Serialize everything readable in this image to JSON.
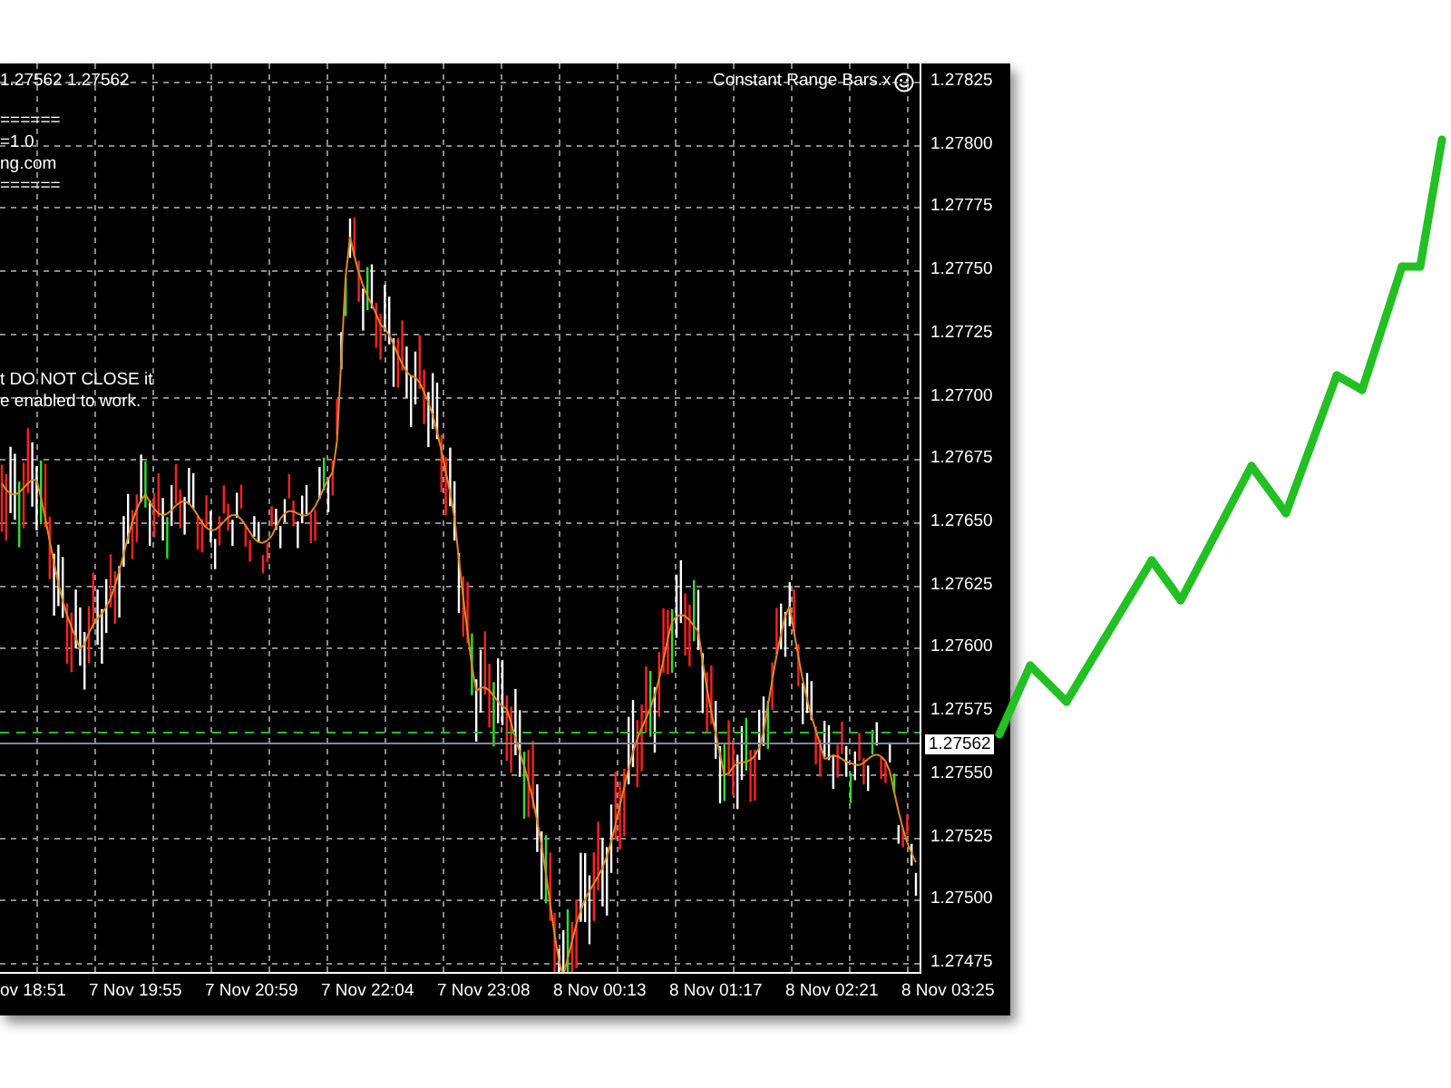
{
  "chart": {
    "header": "1.27562 1.27562",
    "info_lines": [
      "======",
      "=1.0",
      "ng.com",
      "======"
    ],
    "notice_lines": [
      "t DO NOT CLOSE it",
      "e enabled to work."
    ],
    "indicator_label": "Constant Range Bars.x",
    "price_labels": [
      "1.27825",
      "1.27800",
      "1.27775",
      "1.27750",
      "1.27725",
      "1.27700",
      "1.27675",
      "1.27650",
      "1.27625",
      "1.27600",
      "1.27575",
      "1.27550",
      "1.27525",
      "1.27500",
      "1.27475"
    ],
    "current_price": "1.27562",
    "time_labels": [
      "ov 18:51",
      "7 Nov 19:55",
      "7 Nov 20:59",
      "7 Nov 22:04",
      "7 Nov 23:08",
      "8 Nov 00:13",
      "8 Nov 01:17",
      "8 Nov 02:21",
      "8 Nov 03:25"
    ]
  }
}
